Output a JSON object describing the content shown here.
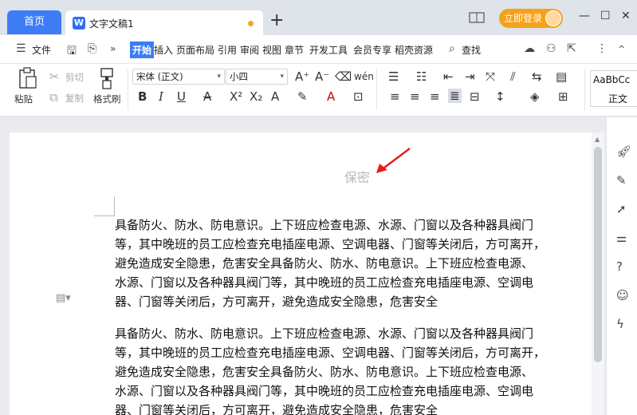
{
  "titlebar": {
    "home_tab": "首页",
    "doc_tab": "文字文稿1",
    "new_tab": "+",
    "login": "立即登录"
  },
  "menu": {
    "file": "文件",
    "items": [
      "开始",
      "插入",
      "页面布局",
      "引用",
      "审阅",
      "视图",
      "章节",
      "开发工具",
      "会员专享",
      "稻壳资源"
    ],
    "search": "查找"
  },
  "ribbon": {
    "paste": "粘贴",
    "cut": "剪切",
    "copy": "复制",
    "format_painter": "格式刷",
    "font_name": "宋体 (正文)",
    "font_size": "小四",
    "style_normal_preview": "AaBbCc",
    "style_normal_label": "正文"
  },
  "document": {
    "header": "保密",
    "paragraph1": [
      "具备防火、防水、防电意识。上下班应检查电源、水源、门窗以及各种器具阀门",
      "等，其中晚班的员工应检查充电插座电源、空调电器、门窗等关闭后，方可离开，",
      "避免造成安全隐患，危害安全具备防火、防水、防电意识。上下班应检查电源、",
      "水源、门窗以及各种器具阀门等，其中晚班的员工应检查充电插座电源、空调电",
      "器、门窗等关闭后，方可离开，避免造成安全隐患，危害安全"
    ],
    "paragraph2": [
      "具备防火、防水、防电意识。上下班应检查电源、水源、门窗以及各种器具阀门",
      "等，其中晚班的员工应检查充电插座电源、空调电器、门窗等关闭后，方可离开，",
      "避免造成安全隐患，危害安全具备防火、防水、防电意识。上下班应检查电源、",
      "水源、门窗以及各种器具阀门等，其中晚班的员工应检查充电插座电源、空调电",
      "器、门窗等关闭后，方可离开，避免造成安全隐患，危害安全"
    ]
  },
  "colors": {
    "accent": "#3d7cf5",
    "login_orange": "#f5a21b",
    "arrow_red": "#e02020"
  }
}
